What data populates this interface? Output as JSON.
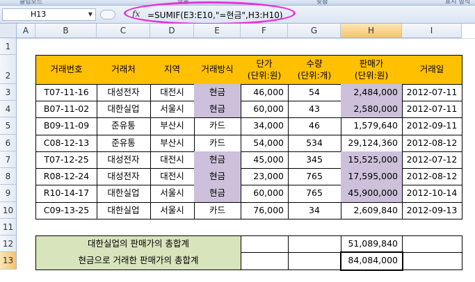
{
  "ribbon": {
    "groups": [
      "클립보드",
      "글꼴",
      "맞춤",
      "표시 형식"
    ]
  },
  "formula_bar": {
    "cell_ref": "H13",
    "fx_symbol": "fx",
    "formula": "=SUMIF(E3:E10,\"=현금\",H3:H10)"
  },
  "sheet": {
    "columns": [
      "A",
      "B",
      "C",
      "D",
      "E",
      "F",
      "G",
      "H",
      "I"
    ],
    "rows": [
      "1",
      "2",
      "3",
      "4",
      "5",
      "6",
      "7",
      "8",
      "9",
      "10",
      "11",
      "12",
      "13"
    ],
    "selected_column": "H",
    "selected_row": "13",
    "headers": {
      "id": "거래번호",
      "client": "거래처",
      "region": "지역",
      "method": "거래방식",
      "price_line1": "단가",
      "price_line2": "(단위:원)",
      "qty_line1": "수량",
      "qty_line2": "(단위:개)",
      "sales_line1": "판매가",
      "sales_line2": "(단위:원)",
      "date": "거래일"
    },
    "records": [
      {
        "id": "T07-11-16",
        "client": "대성전자",
        "region": "대전시",
        "method": "현금",
        "price": "46,000",
        "qty": "54",
        "sales": "2,484,000",
        "date": "2012-07-11",
        "cash": true
      },
      {
        "id": "B07-11-02",
        "client": "대한실업",
        "region": "서울시",
        "method": "현금",
        "price": "60,000",
        "qty": "43",
        "sales": "2,580,000",
        "date": "2012-07-11",
        "cash": true
      },
      {
        "id": "B09-11-09",
        "client": "준유통",
        "region": "부산시",
        "method": "카드",
        "price": "34,000",
        "qty": "46",
        "sales": "1,579,640",
        "date": "2012-09-11",
        "cash": false
      },
      {
        "id": "C08-12-13",
        "client": "준유통",
        "region": "부산시",
        "method": "카드",
        "price": "54,000",
        "qty": "534",
        "sales": "29,124,360",
        "date": "2012-08-12",
        "cash": false
      },
      {
        "id": "T07-12-25",
        "client": "대성전자",
        "region": "대전시",
        "method": "현금",
        "price": "45,000",
        "qty": "345",
        "sales": "15,525,000",
        "date": "2012-07-12",
        "cash": true
      },
      {
        "id": "R08-12-24",
        "client": "대성전자",
        "region": "대전시",
        "method": "현금",
        "price": "23,000",
        "qty": "765",
        "sales": "17,595,000",
        "date": "2012-08-12",
        "cash": true
      },
      {
        "id": "R10-14-17",
        "client": "대한실업",
        "region": "서울시",
        "method": "현금",
        "price": "60,000",
        "qty": "765",
        "sales": "45,900,000",
        "date": "2012-10-14",
        "cash": true
      },
      {
        "id": "C09-13-25",
        "client": "대한실업",
        "region": "서울시",
        "method": "카드",
        "price": "76,000",
        "qty": "34",
        "sales": "2,609,840",
        "date": "2012-09-13",
        "cash": false
      }
    ],
    "summary": [
      {
        "label": "대한실업의 판매가의 총합계",
        "value": "51,089,840"
      },
      {
        "label": "현금으로 거래한 판매가의 총합계",
        "value": "84,084,000"
      }
    ]
  },
  "colors": {
    "header_fill": "#ffc000",
    "cash_fill": "#ccc0da",
    "summary_fill": "#d8e4bc",
    "annotation": "#e634d6"
  }
}
